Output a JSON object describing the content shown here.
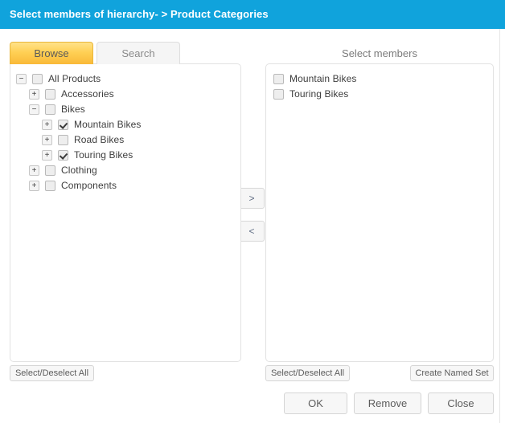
{
  "window": {
    "title": "Select members of hierarchy- > Product Categories",
    "header_color": "#10A3DC"
  },
  "tabs": [
    {
      "label": "Browse",
      "active": true
    },
    {
      "label": "Search",
      "active": false
    }
  ],
  "browse_panel": {
    "tree": [
      {
        "label": "All Products",
        "level": 0,
        "expander": "−",
        "checked": false
      },
      {
        "label": "Accessories",
        "level": 1,
        "expander": "+",
        "checked": false
      },
      {
        "label": "Bikes",
        "level": 1,
        "expander": "−",
        "checked": false
      },
      {
        "label": "Mountain Bikes",
        "level": 2,
        "expander": "+",
        "checked": true
      },
      {
        "label": "Road Bikes",
        "level": 2,
        "expander": "+",
        "checked": false
      },
      {
        "label": "Touring Bikes",
        "level": 2,
        "expander": "+",
        "checked": true
      },
      {
        "label": "Clothing",
        "level": 1,
        "expander": "+",
        "checked": false
      },
      {
        "label": "Components",
        "level": 1,
        "expander": "+",
        "checked": false
      }
    ],
    "select_deselect_all_label": "Select/Deselect All"
  },
  "members_panel": {
    "title": "Select members",
    "members": [
      {
        "label": "Mountain Bikes",
        "checked": false
      },
      {
        "label": "Touring Bikes",
        "checked": false
      }
    ],
    "select_deselect_all_label": "Select/Deselect All",
    "create_named_set_label": "Create Named Set"
  },
  "transfer": {
    "add_label": ">",
    "remove_label": "<"
  },
  "footer": {
    "ok_label": "OK",
    "remove_label": "Remove",
    "close_label": "Close"
  }
}
